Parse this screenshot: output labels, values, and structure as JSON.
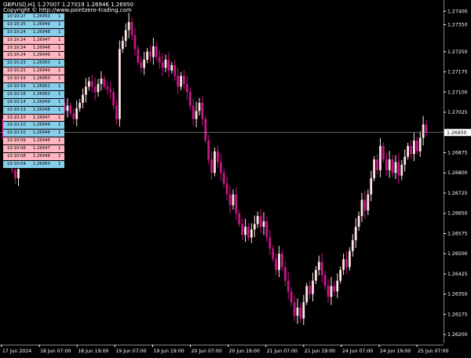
{
  "window": {
    "header_line": "GBPUSD,H1  1.27007 1.27019 1.26946 1.26950",
    "copyright": "Copyright © http://www.pointzero-trading.com"
  },
  "colors": {
    "background": "#000000",
    "bull": "#ffe4e1",
    "bear": "#c71585",
    "axis": "#ffffff",
    "table_up": "#87ceeb",
    "table_down": "#ffb6c1"
  },
  "current_price": {
    "value": 1.2695,
    "label": "1.26950"
  },
  "price_axis": {
    "labels": [
      "1.27400",
      "1.27350",
      "1.27250",
      "1.27175",
      "1.27100",
      "1.27025",
      "1.26875",
      "1.26800",
      "1.26725",
      "1.26650",
      "1.26575",
      "1.26500",
      "1.26425",
      "1.26350",
      "1.26275",
      "1.26200"
    ]
  },
  "time_axis": {
    "labels": [
      "17 Jun 2024",
      "18 Jun 07:00",
      "18 Jun 19:00",
      "19 Jun 07:00",
      "19 Jun 19:00",
      "20 Jun 07:00",
      "20 Jun 19:00",
      "21 Jun 07:00",
      "21 Jun 19:00",
      "24 Jun 07:00",
      "24 Jun 19:00",
      "25 Jun 07:00"
    ]
  },
  "tick_table": [
    {
      "time": "10:10:27",
      "price": "1.26950",
      "vol": "1",
      "dir": "up"
    },
    {
      "time": "10:10:25",
      "price": "1.26949",
      "vol": "1",
      "dir": "up"
    },
    {
      "time": "10:10:24",
      "price": "1.26948",
      "vol": "1",
      "dir": "up"
    },
    {
      "time": "10:10:24",
      "price": "1.26947",
      "vol": "1",
      "dir": "dn"
    },
    {
      "time": "10:10:24",
      "price": "1.26948",
      "vol": "1",
      "dir": "dn"
    },
    {
      "time": "10:10:24",
      "price": "1.26949",
      "vol": "1",
      "dir": "dn"
    },
    {
      "time": "10:10:23",
      "price": "1.26950",
      "vol": "1",
      "dir": "up"
    },
    {
      "time": "10:10:23",
      "price": "1.26949",
      "vol": "1",
      "dir": "dn"
    },
    {
      "time": "10:10:19",
      "price": "1.26950",
      "vol": "1",
      "dir": "dn"
    },
    {
      "time": "10:10:19",
      "price": "1.26951",
      "vol": "1",
      "dir": "up"
    },
    {
      "time": "10:10:18",
      "price": "1.26950",
      "vol": "1",
      "dir": "up"
    },
    {
      "time": "10:10:14",
      "price": "1.26949",
      "vol": "1",
      "dir": "up"
    },
    {
      "time": "10:10:13",
      "price": "1.26948",
      "vol": "1",
      "dir": "up"
    },
    {
      "time": "10:10:10",
      "price": "1.26947",
      "vol": "1",
      "dir": "dn"
    },
    {
      "time": "10:10:10",
      "price": "1.26949",
      "vol": "1",
      "dir": "up"
    },
    {
      "time": "10:10:10",
      "price": "1.26948",
      "vol": "1",
      "dir": "up"
    },
    {
      "time": "10:10:09",
      "price": "1.26946",
      "vol": "1",
      "dir": "dn"
    },
    {
      "time": "10:10:08",
      "price": "1.26947",
      "vol": "1",
      "dir": "dn"
    },
    {
      "time": "10:10:08",
      "price": "1.26948",
      "vol": "2",
      "dir": "dn"
    },
    {
      "time": "10:10:04",
      "price": "1.26950",
      "vol": "1",
      "dir": "up"
    }
  ],
  "chart_data": {
    "type": "candlestick",
    "symbol": "GBPUSD",
    "timeframe": "H1",
    "ylim": [
      1.2618,
      1.2743
    ],
    "closes": [
      1.2693,
      1.2689,
      1.2685,
      1.2681,
      1.2678,
      1.2683,
      1.2687,
      1.2692,
      1.2697,
      1.2701,
      1.2703,
      1.2706,
      1.2704,
      1.2707,
      1.2705,
      1.2703,
      1.2705,
      1.2702,
      1.2704,
      1.2706,
      1.2703,
      1.2705,
      1.2702,
      1.27,
      1.2704,
      1.2706,
      1.2709,
      1.2712,
      1.2714,
      1.2712,
      1.271,
      1.2713,
      1.2715,
      1.2712,
      1.2711,
      1.271,
      1.2705,
      1.27,
      1.2726,
      1.2729,
      1.2733,
      1.2736,
      1.2731,
      1.2726,
      1.2721,
      1.2719,
      1.2722,
      1.2725,
      1.2723,
      1.2727,
      1.2723,
      1.2721,
      1.2719,
      1.2722,
      1.2718,
      1.272,
      1.2716,
      1.2712,
      1.2716,
      1.2713,
      1.271,
      1.2705,
      1.27,
      1.2703,
      1.2706,
      1.27,
      1.2692,
      1.2685,
      1.268,
      1.2688,
      1.2684,
      1.268,
      1.2676,
      1.2672,
      1.2668,
      1.2672,
      1.2665,
      1.2661,
      1.2657,
      1.266,
      1.2656,
      1.2659,
      1.2661,
      1.2664,
      1.266,
      1.2662,
      1.2656,
      1.2652,
      1.2648,
      1.2644,
      1.265,
      1.2645,
      1.264,
      1.2636,
      1.2632,
      1.2627,
      1.263,
      1.2626,
      1.2632,
      1.2638,
      1.2635,
      1.264,
      1.2644,
      1.2647,
      1.2642,
      1.2638,
      1.2634,
      1.2638,
      1.2636,
      1.264,
      1.2644,
      1.2648,
      1.2645,
      1.2651,
      1.2655,
      1.266,
      1.2664,
      1.267,
      1.2666,
      1.2672,
      1.2678,
      1.2685,
      1.2681,
      1.269,
      1.2685,
      1.2681,
      1.2685,
      1.268,
      1.2684,
      1.2679,
      1.2683,
      1.2686,
      1.269,
      1.2687,
      1.2692,
      1.2688,
      1.2693,
      1.2698,
      1.2695
    ]
  }
}
